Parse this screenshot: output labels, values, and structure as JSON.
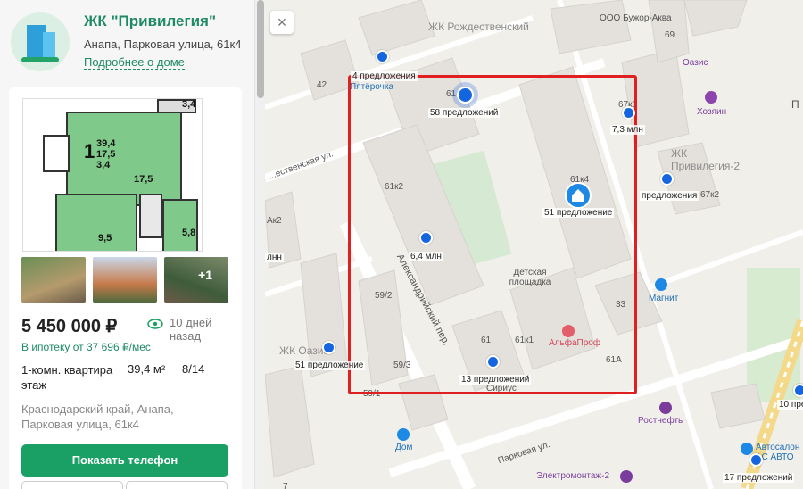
{
  "complex": {
    "title": "ЖК \"Привилегия\"",
    "address": "Анапа, Парковая улица, 61к4",
    "more_link": "Подробнее о доме"
  },
  "listing": {
    "plan": {
      "l1": "39,4",
      "l2": "17,5",
      "l3": "3,4",
      "rooms": "1",
      "r1": "17,5",
      "r2": "9,5",
      "r3": "5,8",
      "balcony": "3,4"
    },
    "photos_more": "+1",
    "price": "5 450 000 ₽",
    "posted": "10 дней назад",
    "mortgage": "В ипотеку от 37 696 ₽/мес",
    "type": "1-комн. квартира",
    "area": "39,4 м²",
    "floor": "8/14",
    "floor_suffix": "этаж",
    "full_address": "Краснодарский край, Анапа, Парковая улица, 61к4",
    "phone_button": "Показать телефон"
  },
  "map": {
    "close_icon": "×",
    "labels": {
      "zhk_rozhd": "ЖК Рождественский",
      "zhk_priv2": "ЖК Привилегия-2",
      "zhk_oazis": "ЖК Оазис",
      "bujor": "ООО Бужор-Аква",
      "oasis_poi": "Оазис",
      "khozyain": "Хозяин",
      "magnit": "Магнит",
      "pyaterochka": "Пятёрочка",
      "alfaprof": "АльфаПроф",
      "sirius": "Сириус",
      "rostneft": "Ростнефть",
      "dom": "Дом",
      "elektromontazh": "Электромонтаж-2",
      "avtosalon": "Автосалон АС АВТО",
      "detskaya": "Детская площадка",
      "street_alex": "Александрийский пер.",
      "street_park": "Парковая ул.",
      "street_rozh": "...ественская ул.",
      "street_p": "П",
      "n42": "42",
      "n69": "69",
      "n61k2": "61к2",
      "n61k4": "61к4",
      "n61k1": "61к1",
      "n61": "61",
      "n61a": "61А",
      "n33": "33",
      "n59_2": "59/2",
      "n59_3": "59/3",
      "n59_1": "59/1",
      "n61top": "61",
      "n67k1": "67к1",
      "n67k2": "67к2",
      "n42b": "Ак2",
      "n7": "7"
    },
    "markers": [
      {
        "label": "58 предложений"
      },
      {
        "label": "7,3 млн"
      },
      {
        "label": "51 предложение"
      },
      {
        "label": "предложения"
      },
      {
        "label": "6,4 млн"
      },
      {
        "label": "51 предложение"
      },
      {
        "label": "13 предложений"
      },
      {
        "label": "10 пред"
      },
      {
        "label": "17 предложений"
      },
      {
        "label": "лнн"
      },
      {
        "label": "4 предложения"
      }
    ]
  }
}
